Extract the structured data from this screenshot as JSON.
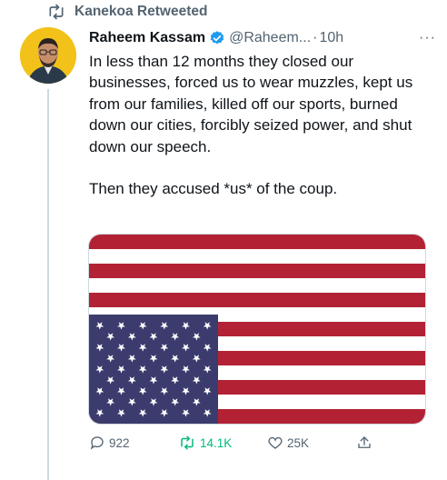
{
  "retweet_banner": {
    "label": "Kanekoa Retweeted"
  },
  "tweet": {
    "author_name": "Raheem Kassam",
    "handle": "@Raheem...",
    "separator": "·",
    "time": "10h",
    "more": "···",
    "text": "In less than 12 months they closed our businesses, forced us to wear muzzles, kept us from our families, killed off our sports, burned down our cities, forcibly seized power, and shut down our speech.\n\nThen they accused *us* of the coup."
  },
  "actions": {
    "replies": "922",
    "retweets": "14.1K",
    "likes": "25K"
  },
  "colors": {
    "accent_blue": "#1d9bf0",
    "retweet_green": "#00ba7c",
    "muted_text": "#536471",
    "flag_red": "#b22234",
    "flag_blue": "#3c3b6e"
  },
  "media": {
    "description_icon": "upside-down-us-flag-icon"
  }
}
